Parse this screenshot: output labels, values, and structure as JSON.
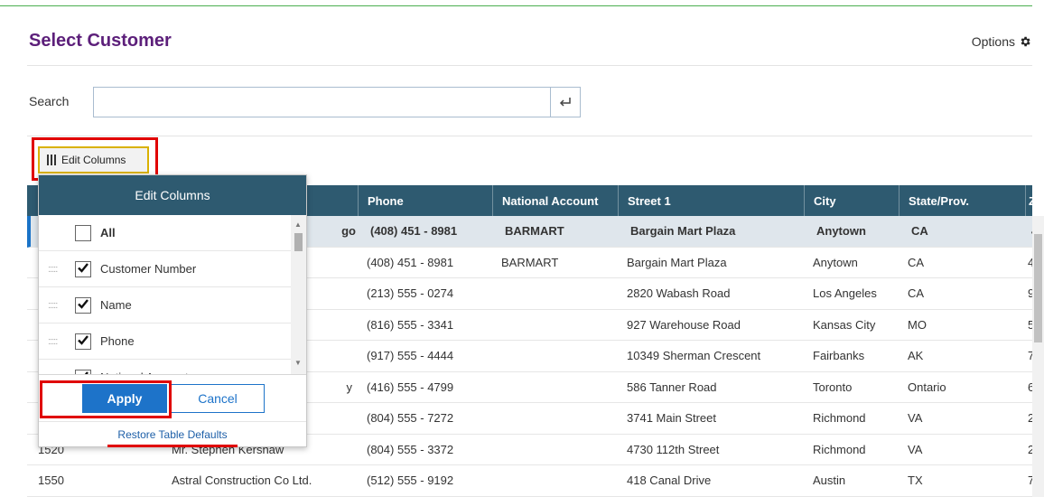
{
  "header": {
    "title": "Select Customer",
    "options_label": "Options"
  },
  "search": {
    "label": "Search",
    "value": "",
    "placeholder": ""
  },
  "toolbar": {
    "edit_columns_label": "Edit Columns"
  },
  "table": {
    "columns": [
      "",
      "",
      "Phone",
      "National Account",
      "Street 1",
      "City",
      "State/Prov.",
      "Z"
    ],
    "rows": [
      {
        "num": "",
        "name": "go",
        "phone": "(408) 451 - 8981",
        "nat": "BARMART",
        "street": "Bargain Mart Plaza",
        "city": "Anytown",
        "state": "CA",
        "zip": "4"
      },
      {
        "num": "",
        "name": "",
        "phone": "(408) 451 - 8981",
        "nat": "BARMART",
        "street": "Bargain Mart Plaza",
        "city": "Anytown",
        "state": "CA",
        "zip": "4"
      },
      {
        "num": "",
        "name": "",
        "phone": "(213) 555 - 0274",
        "nat": "",
        "street": "2820 Wabash Road",
        "city": "Los Angeles",
        "state": "CA",
        "zip": "9"
      },
      {
        "num": "",
        "name": "",
        "phone": "(816) 555 - 3341",
        "nat": "",
        "street": "927 Warehouse Road",
        "city": "Kansas City",
        "state": "MO",
        "zip": "5"
      },
      {
        "num": "",
        "name": "",
        "phone": "(917) 555 - 4444",
        "nat": "",
        "street": "10349 Sherman Crescent",
        "city": "Fairbanks",
        "state": "AK",
        "zip": "7"
      },
      {
        "num": "",
        "name": "y",
        "phone": "(416) 555 - 4799",
        "nat": "",
        "street": "586 Tanner Road",
        "city": "Toronto",
        "state": "Ontario",
        "zip": "6"
      },
      {
        "num": "",
        "name": "",
        "phone": "(804) 555 - 7272",
        "nat": "",
        "street": "3741 Main Street",
        "city": "Richmond",
        "state": "VA",
        "zip": "2"
      },
      {
        "num": "1520",
        "name": "Mr. Stephen Kershaw",
        "phone": "(804) 555 - 3372",
        "nat": "",
        "street": "4730 112th Street",
        "city": "Richmond",
        "state": "VA",
        "zip": "2"
      },
      {
        "num": "1550",
        "name": "Astral Construction Co Ltd.",
        "phone": "(512) 555 - 9192",
        "nat": "",
        "street": "418 Canal Drive",
        "city": "Austin",
        "state": "TX",
        "zip": "7"
      }
    ]
  },
  "popup": {
    "title": "Edit Columns",
    "items": [
      {
        "label": "All",
        "checked": false
      },
      {
        "label": "Customer Number",
        "checked": true
      },
      {
        "label": "Name",
        "checked": true
      },
      {
        "label": "Phone",
        "checked": true
      },
      {
        "label": "National Account",
        "checked": true
      }
    ],
    "apply_label": "Apply",
    "cancel_label": "Cancel",
    "restore_label": "Restore Table Defaults"
  },
  "colors": {
    "title": "#5c1f7a",
    "table_header": "#2e5a70",
    "accent": "#1d73c9",
    "highlight": "#e00000"
  },
  "icons": {
    "options": "gear-icon",
    "search_submit": "enter-icon",
    "edit_columns": "columns-icon",
    "check": "check-icon",
    "drag": "drag-handle-icon"
  }
}
